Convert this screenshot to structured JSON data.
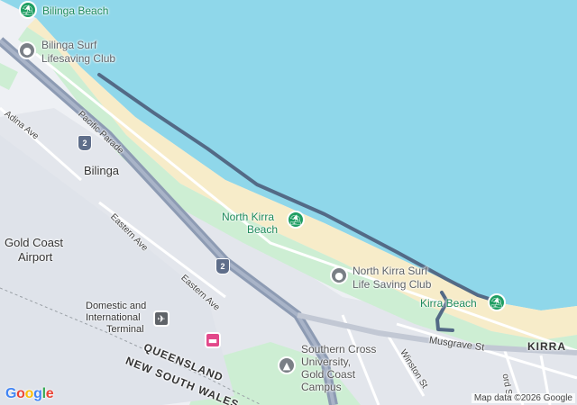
{
  "map": {
    "colors": {
      "water": "#8fd7ea",
      "sand": "#f7ecc9",
      "park": "#cdeed3",
      "land": "#eef0f4",
      "urban": "#e3e6ec",
      "highway": "#8d9bb3",
      "route": "#536a86"
    },
    "places": {
      "bilinga_beach": "Bilinga Beach",
      "bilinga_surf_1": "Bilinga Surf",
      "bilinga_surf_2": "Lifesaving Club",
      "north_kirra_beach_1": "North Kirra",
      "north_kirra_beach_2": "Beach",
      "nk_surf_1": "North Kirra Surf",
      "nk_surf_2": "Life Saving Club",
      "kirra_beach": "Kirra Beach",
      "kirra": "KIRRA",
      "bilinga": "Bilinga",
      "airport_1": "Gold Coast",
      "airport_2": "Airport",
      "terminal_1": "Domestic and",
      "terminal_2": "International",
      "terminal_3": "Terminal",
      "university_1": "Southern Cross",
      "university_2": "University,",
      "university_3": "Gold Coast",
      "university_4": "Campus"
    },
    "streets": {
      "adina": "Adina Ave",
      "pacific": "Pacific Parade",
      "eastern_1": "Eastern Ave",
      "eastern_2": "Eastern Ave",
      "musgrave": "Musgrave St",
      "winston": "Winston St",
      "ford": "ord St"
    },
    "states": {
      "qld": "QUEENSLAND",
      "nsw": "NEW SOUTH WALES"
    },
    "route_shields": {
      "shield_1": "2",
      "shield_2": "2"
    },
    "icons": {
      "beach": "beach-umbrella-icon",
      "place": "place-dot-icon",
      "airport": "airplane-icon",
      "hotel": "hotel-bed-icon",
      "university": "graduation-cap-icon"
    },
    "attribution": "Map data ©2026 Google",
    "logo": "Google"
  }
}
